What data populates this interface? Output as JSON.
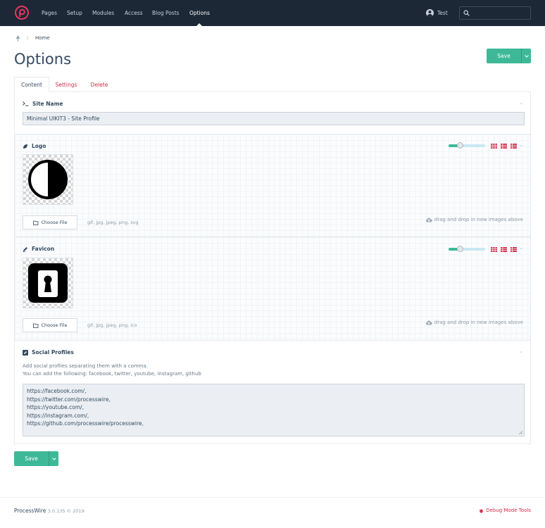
{
  "nav": {
    "items": [
      "Pages",
      "Setup",
      "Modules",
      "Access",
      "Blog Posts",
      "Options"
    ],
    "user": "Test",
    "search_placeholder": ""
  },
  "breadcrumb": {
    "home": "Home",
    "separator": "/"
  },
  "page": {
    "title": "Options",
    "save_label": "Save"
  },
  "tabs": [
    "Content",
    "Settings",
    "Delete"
  ],
  "fields": {
    "site_name": {
      "label": "Site Name",
      "value": "Minimal UIKIT3 - Site Profile"
    },
    "logo": {
      "label": "Logo",
      "choose": "Choose File",
      "exts": "gif, jpg, jpeg, png, svg",
      "drag": "drag and drop in new images above",
      "thumb_size": 0.25
    },
    "favicon": {
      "label": "Favicon",
      "choose": "Choose File",
      "exts": "gif, jpg, jpeg, png, ico",
      "drag": "drag and drop in new images above",
      "thumb_size": 0.25
    },
    "social": {
      "label": "Social Profiles",
      "desc1": "Add social profiles separating them with a comma.",
      "desc2": "You can add the following: facebook, twitter, youtube, instagram, github",
      "lines": [
        "https://facebook.com/,",
        "https://twitter.com/processwire,",
        "https://youtube.com/,",
        "https://instagram.com/,",
        "https://github.com/processwire/processwire,"
      ]
    }
  },
  "footer": {
    "brand": "ProcessWire",
    "version": "3.0.135 © 2019",
    "debug": "Debug Mode Tools"
  },
  "colors": {
    "nav_bg": "#1c2836",
    "accent": "#3eb998",
    "link": "#d32d4a"
  }
}
